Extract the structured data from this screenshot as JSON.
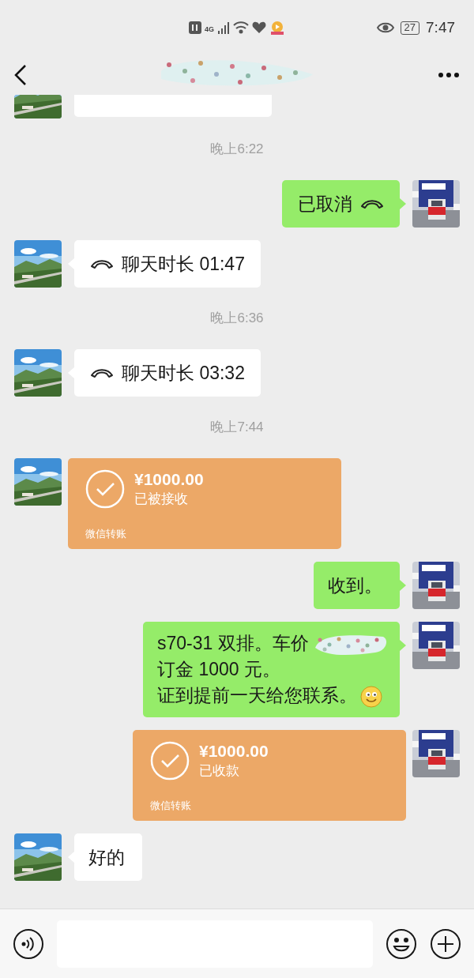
{
  "status_bar": {
    "network": "4G",
    "battery": "27",
    "time": "7:47"
  },
  "messages": [
    {
      "kind": "time",
      "text": "晚上6:22"
    },
    {
      "kind": "call",
      "outgoing": true,
      "text": "已取消"
    },
    {
      "kind": "call",
      "outgoing": false,
      "text": "聊天时长 01:47"
    },
    {
      "kind": "time",
      "text": "晚上6:36"
    },
    {
      "kind": "call",
      "outgoing": false,
      "text": "聊天时长 03:32"
    },
    {
      "kind": "time",
      "text": "晚上7:44"
    },
    {
      "kind": "transfer",
      "outgoing": false,
      "amount": "¥1000.00",
      "status": "已被接收",
      "footer": "微信转账"
    },
    {
      "kind": "text",
      "outgoing": true,
      "lines": [
        {
          "text": "收到。"
        }
      ]
    },
    {
      "kind": "text",
      "outgoing": true,
      "lines": [
        {
          "text": "s70-31 双排。车价",
          "redacted": true
        },
        {
          "text": "订金 1000 元。"
        },
        {
          "text": "证到提前一天给您联系。",
          "emoji": true
        }
      ]
    },
    {
      "kind": "transfer",
      "outgoing": true,
      "amount": "¥1000.00",
      "status": "已收款",
      "footer": "微信转账"
    },
    {
      "kind": "text",
      "outgoing": false,
      "lines": [
        {
          "text": "好的"
        }
      ]
    }
  ]
}
